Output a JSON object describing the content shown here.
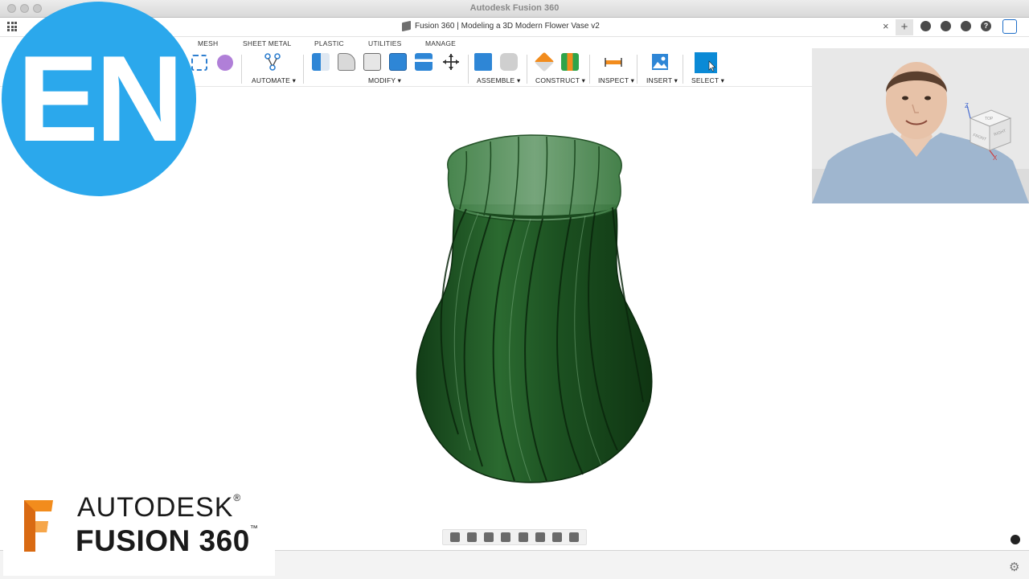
{
  "window": {
    "title": "Autodesk Fusion 360"
  },
  "document_tab": {
    "title": "Fusion 360 | Modeling a 3D Modern Flower Vase v2",
    "close": "×",
    "new_tab": "+"
  },
  "menu_tabs": [
    "MESH",
    "SHEET METAL",
    "PLASTIC",
    "UTILITIES",
    "MANAGE"
  ],
  "groups": {
    "automate": "AUTOMATE ▾",
    "modify": "MODIFY ▾",
    "assemble": "ASSEMBLE ▾",
    "construct": "CONSTRUCT ▾",
    "inspect": "INSPECT ▾",
    "insert": "INSERT ▾",
    "select": "SELECT ▾"
  },
  "top_icons": [
    "?"
  ],
  "overlay": {
    "badge": "EN"
  },
  "logo": {
    "autodesk": "AUTODESK",
    "registered": "®",
    "product": "FUSION 360",
    "trademark": "™"
  },
  "colors": {
    "accent_blue": "#2ba8ec",
    "vase_green": "#1f5a24",
    "select_blue": "#0b8ad6",
    "logo_orange": "#f28c1d"
  },
  "viewcube": {
    "top": "TOP",
    "front": "FRONT",
    "right": "RIGHT",
    "z": "Z",
    "x": "X"
  },
  "icons": [
    "grid-icon",
    "document-icon",
    "job-status-icon",
    "notifications-icon",
    "help-icon",
    "settings-gear-icon"
  ]
}
